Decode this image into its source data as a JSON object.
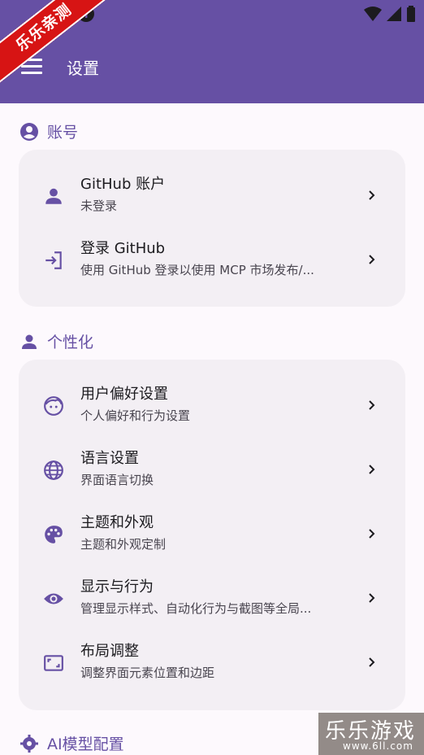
{
  "badge": "乐乐亲测",
  "appbar": {
    "title": "设置"
  },
  "sections": [
    {
      "title": "账号",
      "icon": "account-circle-icon",
      "items": [
        {
          "label": "GitHub 账户",
          "subtitle": "未登录",
          "icon": "person-icon"
        },
        {
          "label": "登录 GitHub",
          "subtitle": "使用 GitHub 登录以使用 MCP 市场发布/...",
          "icon": "login-icon"
        }
      ]
    },
    {
      "title": "个性化",
      "icon": "person-icon",
      "items": [
        {
          "label": "用户偏好设置",
          "subtitle": "个人偏好和行为设置",
          "icon": "face-icon"
        },
        {
          "label": "语言设置",
          "subtitle": "界面语言切换",
          "icon": "globe-icon"
        },
        {
          "label": "主题和外观",
          "subtitle": "主题和外观定制",
          "icon": "palette-icon"
        },
        {
          "label": "显示与行为",
          "subtitle": "管理显示样式、自动化行为与截图等全局...",
          "icon": "eye-icon"
        },
        {
          "label": "布局调整",
          "subtitle": "调整界面元素位置和边距",
          "icon": "aspect-ratio-icon"
        }
      ]
    },
    {
      "title": "AI模型配置",
      "icon": "gear-icon",
      "items": []
    }
  ],
  "watermark": {
    "main": "乐乐游戏",
    "url": "www.6ll.com"
  },
  "colors": {
    "primary": "#6650a4",
    "card": "#f3eff4",
    "background": "#fdf9fd"
  }
}
